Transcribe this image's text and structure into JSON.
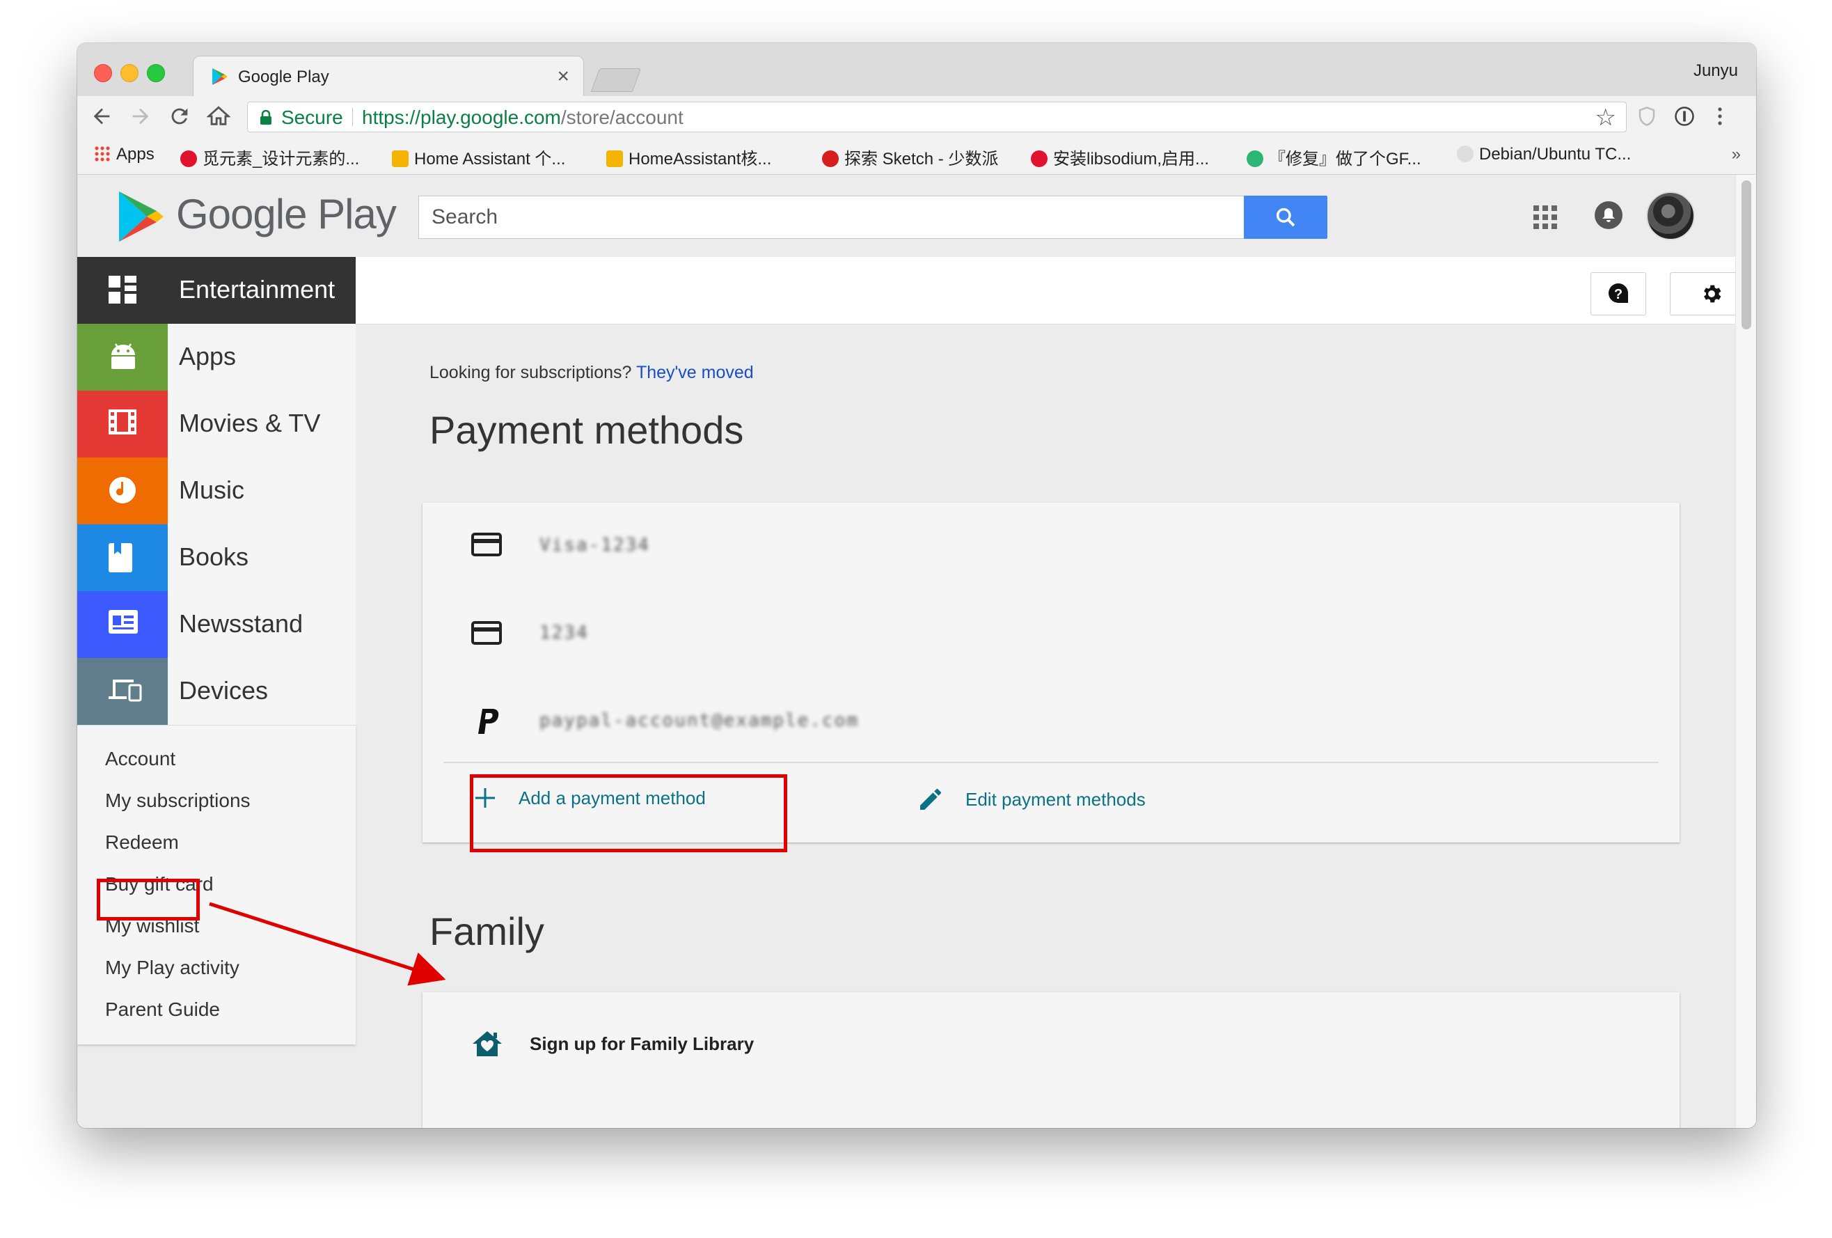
{
  "browser": {
    "tab_title": "Google Play",
    "tab_close": "×",
    "profile_name": "Junyu",
    "secure_label": "Secure",
    "url_scheme_host": "https://play.google.com",
    "url_path": "/store/account",
    "bookmarks": [
      {
        "label": "Apps",
        "color": "#ea4335"
      },
      {
        "label": "觅元素_设计元素的...",
        "color": "#e0122d"
      },
      {
        "label": "Home Assistant 个...",
        "color": "#f5b400"
      },
      {
        "label": "HomeAssistant核...",
        "color": "#f5b400"
      },
      {
        "label": "探索 Sketch - 少数派",
        "color": "#d71e1e"
      },
      {
        "label": "安装libsodium,启用...",
        "color": "#e0122d"
      },
      {
        "label": "『修复』做了个GF...",
        "color": "#2bb673"
      },
      {
        "label": "Debian/Ubuntu TC...",
        "color": "#555555"
      }
    ],
    "bookmarks_more": "»"
  },
  "header": {
    "logo_text": "Google Play",
    "search_placeholder": "Search"
  },
  "nav": {
    "main": [
      {
        "label": "Entertainment",
        "icon": "entertainment-icon"
      },
      {
        "label": "Apps",
        "icon": "android-icon"
      },
      {
        "label": "Movies & TV",
        "icon": "film-icon"
      },
      {
        "label": "Music",
        "icon": "music-icon"
      },
      {
        "label": "Books",
        "icon": "book-icon"
      },
      {
        "label": "Newsstand",
        "icon": "newsstand-icon"
      },
      {
        "label": "Devices",
        "icon": "devices-icon"
      }
    ],
    "sub": [
      "Account",
      "My subscriptions",
      "Redeem",
      "Buy gift card",
      "My wishlist",
      "My Play activity",
      "Parent Guide"
    ]
  },
  "main": {
    "subs_note": "Looking for subscriptions?",
    "subs_link": "They've moved",
    "payment_title": "Payment methods",
    "payment_items": [
      {
        "type": "card",
        "text": "Visa-1234"
      },
      {
        "type": "card",
        "text": "1234"
      },
      {
        "type": "paypal",
        "text": "paypal-account@example.com"
      }
    ],
    "add_payment": "Add a payment method",
    "edit_payment": "Edit payment methods",
    "family_title": "Family",
    "family_signup": "Sign up for Family Library"
  },
  "colors": {
    "accent_red_annotation": "#e00000",
    "action_teal": "#0b7285",
    "search_blue": "#4285f4"
  }
}
